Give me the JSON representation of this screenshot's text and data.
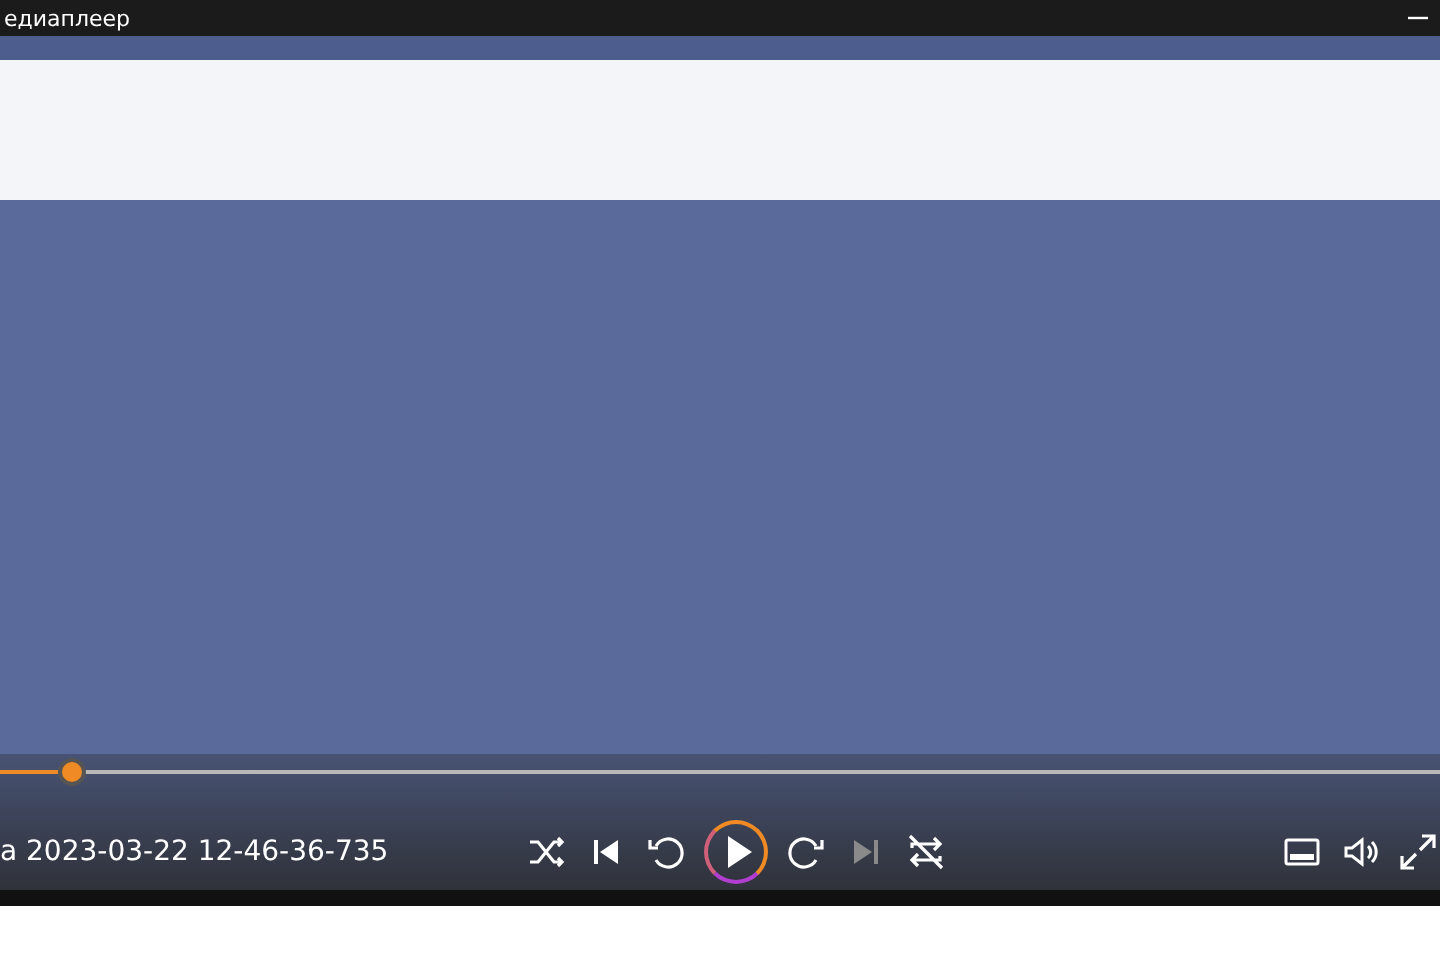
{
  "window": {
    "title": "едиаплеер"
  },
  "player": {
    "progress": {
      "level": 0.05
    },
    "media_title": "а 2023-03-22 12-46-36-735",
    "controls": [
      {
        "kind": "shuffle",
        "disabled": false
      },
      {
        "kind": "previous",
        "disabled": false
      },
      {
        "kind": "rewind",
        "disabled": false
      },
      {
        "kind": "play",
        "disabled": false
      },
      {
        "kind": "forward",
        "disabled": false
      },
      {
        "kind": "next",
        "disabled": true
      },
      {
        "kind": "repeat",
        "disabled": false
      }
    ],
    "side_controls": [
      {
        "kind": "miniplayer"
      },
      {
        "kind": "volume"
      },
      {
        "kind": "fullscreen"
      }
    ]
  }
}
